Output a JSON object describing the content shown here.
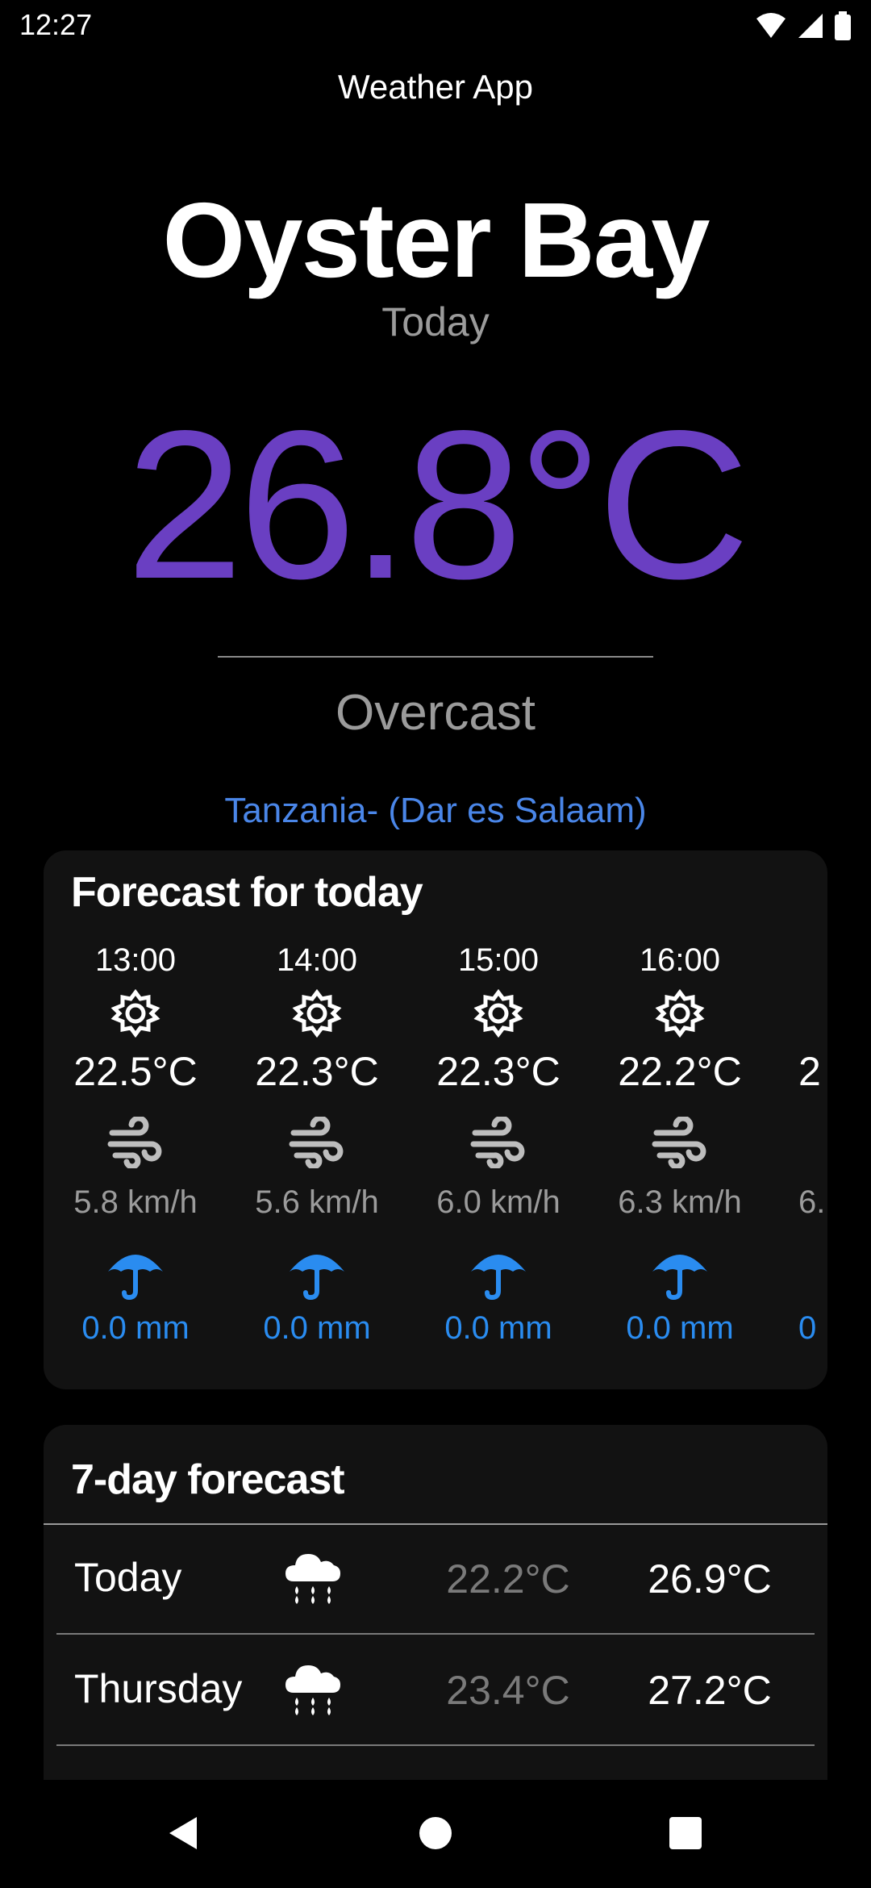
{
  "status": {
    "time": "12:27"
  },
  "app_title": "Weather App",
  "location": {
    "city": "Oyster Bay",
    "day": "Today",
    "temperature": "26.8°C",
    "condition": "Overcast",
    "region": "Tanzania- (Dar es Salaam)"
  },
  "hourly": {
    "title": "Forecast for today",
    "items": [
      {
        "time": "13:00",
        "temp": "22.5°C",
        "wind": "5.8 km/h",
        "rain": "0.0 mm",
        "icon": "sun-gear-icon"
      },
      {
        "time": "14:00",
        "temp": "22.3°C",
        "wind": "5.6 km/h",
        "rain": "0.0 mm",
        "icon": "sun-gear-icon"
      },
      {
        "time": "15:00",
        "temp": "22.3°C",
        "wind": "6.0 km/h",
        "rain": "0.0 mm",
        "icon": "sun-gear-icon"
      },
      {
        "time": "16:00",
        "temp": "22.2°C",
        "wind": "6.3 km/h",
        "rain": "0.0 mm",
        "icon": "sun-gear-icon"
      },
      {
        "time": "",
        "temp": "2",
        "wind": "6.",
        "rain": "0",
        "icon": ""
      }
    ]
  },
  "weekly": {
    "title": "7-day forecast",
    "days": [
      {
        "name": "Today",
        "min": "22.2°C",
        "max": "26.9°C",
        "icon": "rain-cloud-icon"
      },
      {
        "name": "Thursday",
        "min": "23.4°C",
        "max": "27.2°C",
        "icon": "rain-cloud-icon"
      }
    ]
  },
  "colors": {
    "accent_temp": "#6a3fc2",
    "region_link": "#4a86e8",
    "rain_blue": "#2a8cf0"
  }
}
